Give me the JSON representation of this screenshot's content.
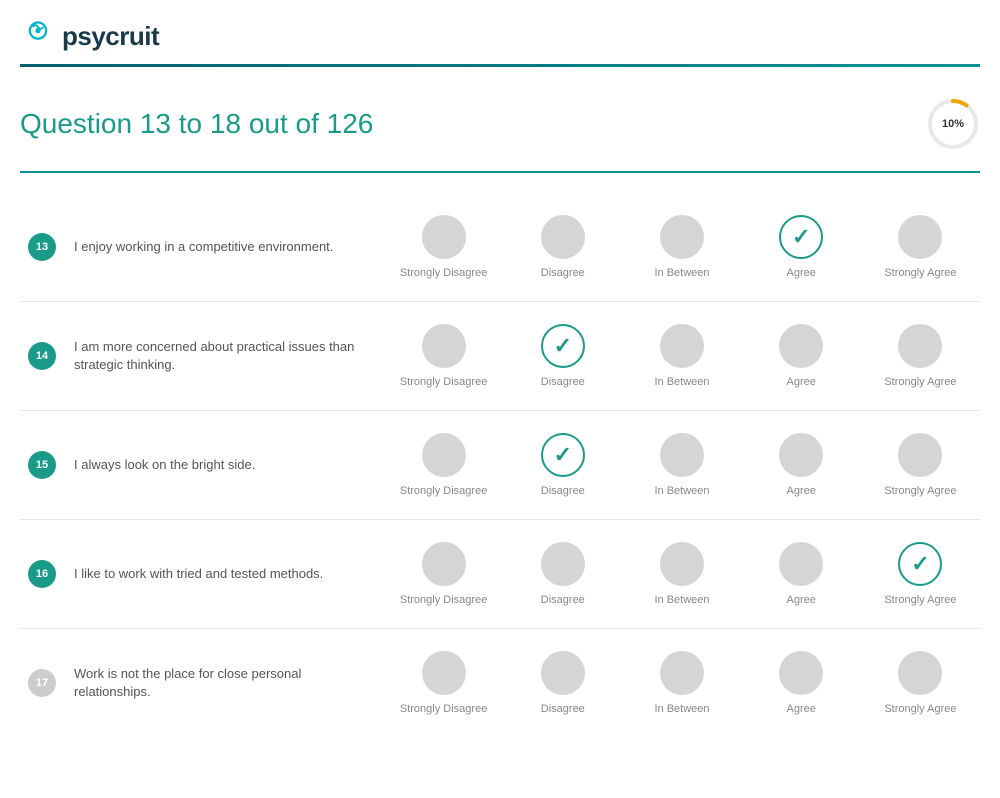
{
  "header": {
    "logo_text": "psycruit",
    "title": "Question 13 to 18 out of 126",
    "progress_percent": "10%",
    "progress_value": 10
  },
  "options": {
    "labels": [
      "Strongly Disagree",
      "Disagree",
      "In Between",
      "Agree",
      "Strongly Agree"
    ]
  },
  "questions": [
    {
      "number": "13",
      "text": "I enjoy working in a competitive environment.",
      "selected": 3,
      "active": true
    },
    {
      "number": "14",
      "text": "I am more concerned about practical issues than strategic thinking.",
      "selected": 1,
      "active": true
    },
    {
      "number": "15",
      "text": "I always look on the bright side.",
      "selected": 1,
      "active": true
    },
    {
      "number": "16",
      "text": "I like to work with tried and tested methods.",
      "selected": 4,
      "active": true
    },
    {
      "number": "17",
      "text": "Work is not the place for close personal relationships.",
      "selected": -1,
      "active": false
    }
  ]
}
